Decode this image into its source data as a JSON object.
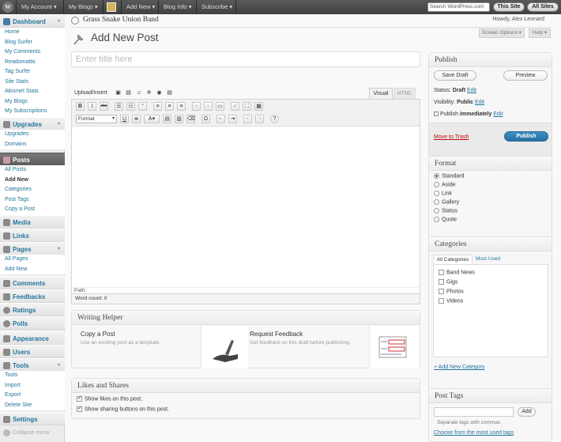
{
  "adminbar": {
    "my_account": "My Account ▾",
    "my_blogs": "My Blogs ▾",
    "add_new": "Add New ▾",
    "blog_info": "Blog Info ▾",
    "subscribe": "Subscribe ▾",
    "search_placeholder": "Search WordPress.com",
    "this_site": "This Site",
    "all_sites": "All Sites"
  },
  "header": {
    "site_name": "Grass Snake Union Band",
    "howdy": "Howdy, Alex Leonard",
    "screen_options": "Screen Options ▾",
    "help": "Help ▾",
    "page_title": "Add New Post"
  },
  "menu": {
    "dashboard": "Dashboard",
    "dashboard_items": [
      "Home",
      "Blog Surfer",
      "My Comments",
      "Readomattic",
      "Tag Surfer",
      "Site Stats",
      "Akismet Stats",
      "My Blogs",
      "My Subscriptions"
    ],
    "upgrades": "Upgrades",
    "upgrades_items": [
      "Upgrades",
      "Domains"
    ],
    "posts": "Posts",
    "posts_items": [
      "All Posts",
      "Add New",
      "Categories",
      "Post Tags",
      "Copy a Post"
    ],
    "media": "Media",
    "links": "Links",
    "pages": "Pages",
    "pages_items": [
      "All Pages",
      "Add New"
    ],
    "comments": "Comments",
    "feedbacks": "Feedbacks",
    "ratings": "Ratings",
    "polls": "Polls",
    "appearance": "Appearance",
    "users": "Users",
    "tools": "Tools",
    "tools_items": [
      "Tools",
      "Import",
      "Export",
      "Delete Site"
    ],
    "settings": "Settings",
    "collapse": "Collapse menu"
  },
  "editor": {
    "title_placeholder": "Enter title here",
    "upload_insert": "Upload/Insert",
    "tab_visual": "Visual",
    "tab_html": "HTML",
    "format_select": "Format",
    "path": "Path:",
    "word_count": "Word count: 0"
  },
  "writing_helper": {
    "title": "Writing Helper",
    "copy_title": "Copy a Post",
    "copy_desc": "Use an existing post as a template.",
    "feedback_title": "Request Feedback",
    "feedback_desc": "Get feedback on this draft before publishing."
  },
  "likes": {
    "title": "Likes and Shares",
    "show_likes": "Show likes on this post.",
    "show_sharing": "Show sharing buttons on this post."
  },
  "publish": {
    "title": "Publish",
    "save_draft": "Save Draft",
    "preview": "Preview",
    "status_label": "Status:",
    "status_value": "Draft",
    "visibility_label": "Visibility:",
    "visibility_value": "Public",
    "publish_label": "Publish",
    "publish_value": "immediately",
    "edit": "Edit",
    "trash": "Move to Trash",
    "publish_btn": "Publish"
  },
  "format": {
    "title": "Format",
    "options": [
      "Standard",
      "Aside",
      "Link",
      "Gallery",
      "Status",
      "Quote"
    ],
    "selected": "Standard"
  },
  "categories": {
    "title": "Categories",
    "tab_all": "All Categories",
    "tab_most": "Most Used",
    "items": [
      "Band News",
      "Gigs",
      "Photos",
      "Videos"
    ],
    "add_new": "+ Add New Category"
  },
  "tags": {
    "title": "Post Tags",
    "add": "Add",
    "hint": "Separate tags with commas",
    "choose": "Choose from the most used tags"
  },
  "colors": {
    "link": "#21759b",
    "publish_button": "#2a7fb8",
    "trash": "#bc0b0b"
  }
}
